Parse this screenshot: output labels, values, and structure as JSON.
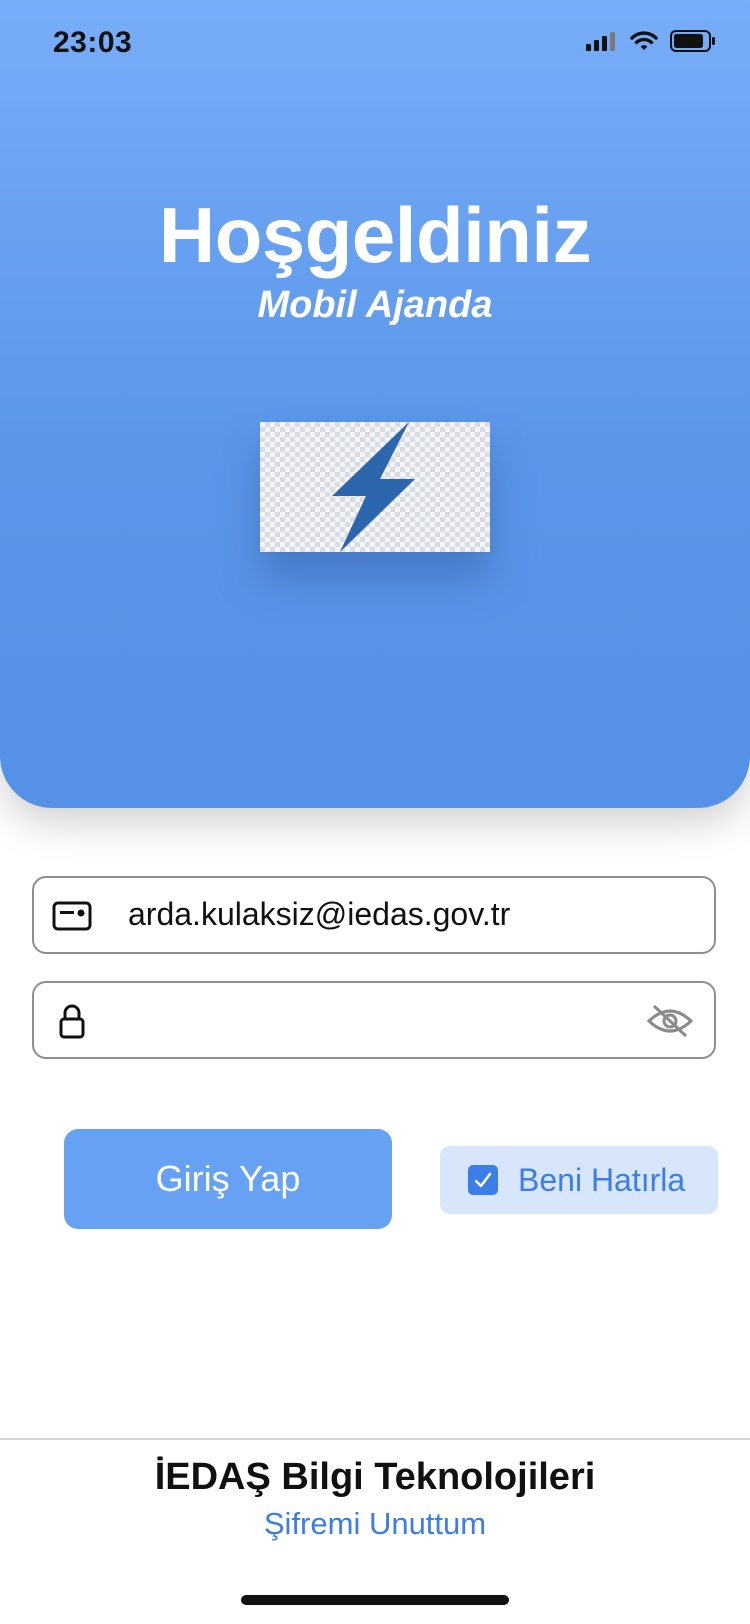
{
  "status_bar": {
    "time": "23:03"
  },
  "hero": {
    "title": "Hoşgeldiniz",
    "subtitle": "Mobil Ajanda"
  },
  "login_form": {
    "email_value": "arda.kulaksiz@iedas.gov.tr",
    "password_value": "",
    "login_button": "Giriş Yap",
    "remember_label": "Beni Hatırla",
    "remember_checked": true
  },
  "footer": {
    "company": "İEDAŞ Bilgi Teknolojileri",
    "forgot_password": "Şifremi Unuttum"
  },
  "colors": {
    "hero_top": "#78adf8",
    "hero_bottom": "#5491e7",
    "button": "#66a1f4",
    "accent": "#3d7de6",
    "bolt": "#2c67ad"
  },
  "icons": {
    "email_field": "id-card-icon",
    "password_field": "lock-icon",
    "password_toggle": "eye-slash-icon",
    "logo": "lightning-bolt-icon"
  }
}
